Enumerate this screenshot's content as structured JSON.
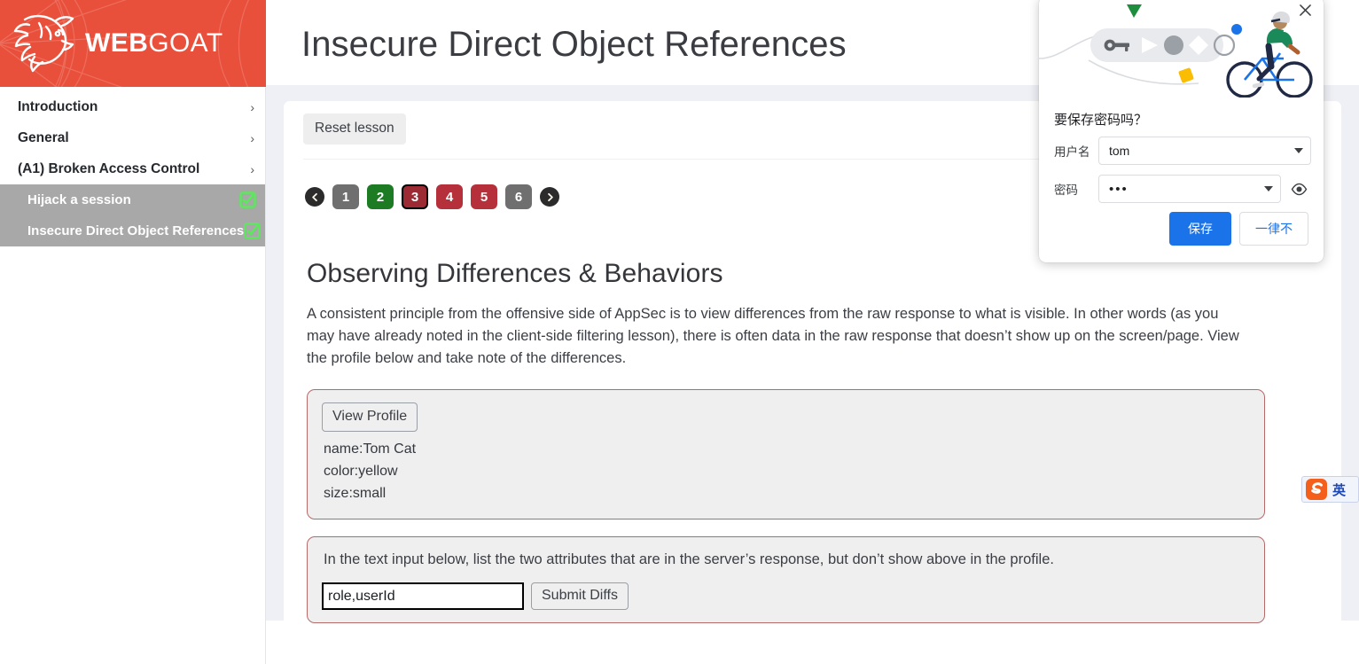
{
  "brand": {
    "name_bold": "WEB",
    "name_light": "GOAT",
    "logo_icon": "goat-head-icon",
    "background_color": "#e9503c"
  },
  "sidebar": {
    "categories": [
      {
        "label": "Introduction",
        "chevron": "›"
      },
      {
        "label": "General",
        "chevron": "›"
      },
      {
        "label": "(A1) Broken Access Control",
        "chevron": "›"
      }
    ],
    "lessons": [
      {
        "label": "Hijack a session",
        "status_icon": "check-square-icon",
        "completed": true
      },
      {
        "label": "Insecure Direct Object References",
        "status_icon": "check-square-icon",
        "completed": true
      }
    ],
    "selected_lesson": "Insecure Direct Object References",
    "highlight_color": "#a8a8a8",
    "check_color": "#5ce85c"
  },
  "header": {
    "title": "Insecure Direct Object References"
  },
  "toolbar": {
    "reset_label": "Reset lesson"
  },
  "pagination": {
    "prev_icon": "arrow-left-circle-icon",
    "next_icon": "arrow-right-circle-icon",
    "pages": [
      {
        "number": "1",
        "state": "gray"
      },
      {
        "number": "2",
        "state": "green"
      },
      {
        "number": "3",
        "state": "current"
      },
      {
        "number": "4",
        "state": "red"
      },
      {
        "number": "5",
        "state": "red"
      },
      {
        "number": "6",
        "state": "gray"
      }
    ],
    "current_page": "3"
  },
  "lesson": {
    "section_title": "Observing Differences & Behaviors",
    "paragraph": "A consistent principle from the offensive side of AppSec is to view differences from the raw response to what is visible. In other words (as you may have already noted in the client-side filtering lesson), there is often data in the raw response that doesn’t show up on the screen/page. View the profile below and take note of the differences.",
    "profile": {
      "button_label": "View Profile",
      "lines": [
        "name:Tom Cat",
        "color:yellow",
        "size:small"
      ]
    },
    "diff": {
      "prompt": "In the text input below, list the two attributes that are in the server’s response, but don’t show above in the profile.",
      "input_value": "role,userId",
      "input_placeholder": "",
      "submit_label": "Submit Diffs"
    },
    "outline_color": "#b56a6a"
  },
  "password_dialog": {
    "close_icon": "close-icon",
    "hero_icon": "cyclist-password-illustration",
    "question": "要保存密码吗？",
    "username_label": "用户名",
    "username_value": "tom",
    "password_label": "密码",
    "password_masked": "•••",
    "reveal_icon": "eye-icon",
    "dropdown_icon": "chevron-down-icon",
    "save_label": "保存",
    "never_label": "一律不",
    "primary_color": "#1a73e8"
  },
  "ime": {
    "logo_icon": "sogou-logo-icon",
    "mode_label": "英",
    "mode_color": "#1d49b5"
  }
}
